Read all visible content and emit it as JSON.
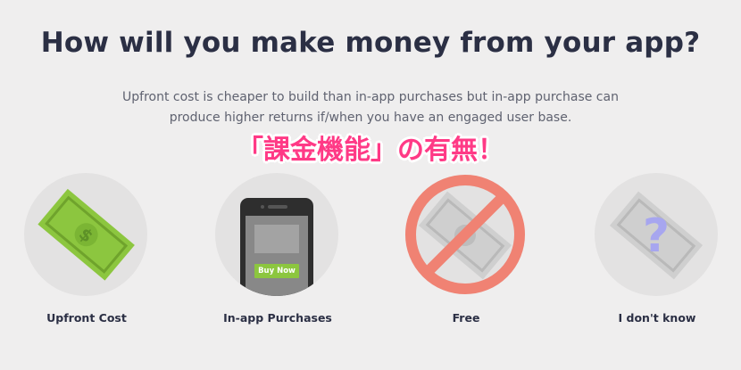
{
  "header": {
    "title": "How will you make money from your app?",
    "subtitle": "Upfront cost is cheaper to build than in-app purchases but in-app purchase can produce higher returns if/when you have an engaged user base."
  },
  "annotation": "「課金機能」の有無！",
  "options": [
    {
      "label": "Upfront Cost",
      "icon": "money-bill-icon"
    },
    {
      "label": "In-app Purchases",
      "icon": "smartphone-icon",
      "button_label": "Buy Now"
    },
    {
      "label": "Free",
      "icon": "no-money-icon"
    },
    {
      "label": "I don't know",
      "icon": "question-money-icon"
    }
  ],
  "colors": {
    "background": "#efeeee",
    "circle": "#e3e2e2",
    "title": "#2b2f44",
    "annotation": "#ff3a86",
    "money_green": "#8cc63f",
    "prohibit_red": "#f08273",
    "question": "#a7a6ef"
  }
}
